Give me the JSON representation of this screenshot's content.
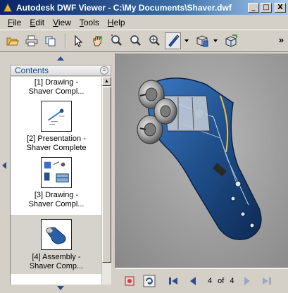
{
  "window": {
    "title": "Autodesk DWF Viewer - C:\\My Documents\\Shaver.dwf",
    "minimize": "_",
    "maximize": "□",
    "close": "X"
  },
  "menu": [
    {
      "label": "File",
      "u": "F",
      "rest": "ile"
    },
    {
      "label": "Edit",
      "u": "E",
      "rest": "dit"
    },
    {
      "label": "View",
      "u": "V",
      "rest": "iew"
    },
    {
      "label": "Tools",
      "u": "T",
      "rest": "ools"
    },
    {
      "label": "Help",
      "u": "H",
      "rest": "elp"
    }
  ],
  "toolbar": {
    "more": "»",
    "buttons": [
      "open-icon",
      "print-icon",
      "copy-icon",
      "select-icon",
      "pan-icon",
      "zoom-icon",
      "zoom-rectangle-icon",
      "fit-icon",
      "markup-icon",
      "model-view-icon",
      "publish-icon"
    ]
  },
  "contents": {
    "header": "Contents",
    "items": [
      {
        "line1": "[1] Drawing -",
        "line2": "Shaver Compl..."
      },
      {
        "line1": "[2] Presentation -",
        "line2": "Shaver Complete"
      },
      {
        "line1": "[3] Drawing -",
        "line2": "Shaver Compl..."
      },
      {
        "line1": "[4] Assembly -",
        "line2": "Shaver Comp...",
        "selected": true
      }
    ]
  },
  "navigation": {
    "current_page": "4",
    "of_label": "of",
    "total_pages": "4"
  },
  "colors": {
    "accent": "#0a246a",
    "model_blue": "#1f4f8a",
    "background": "#d4d0c8"
  }
}
